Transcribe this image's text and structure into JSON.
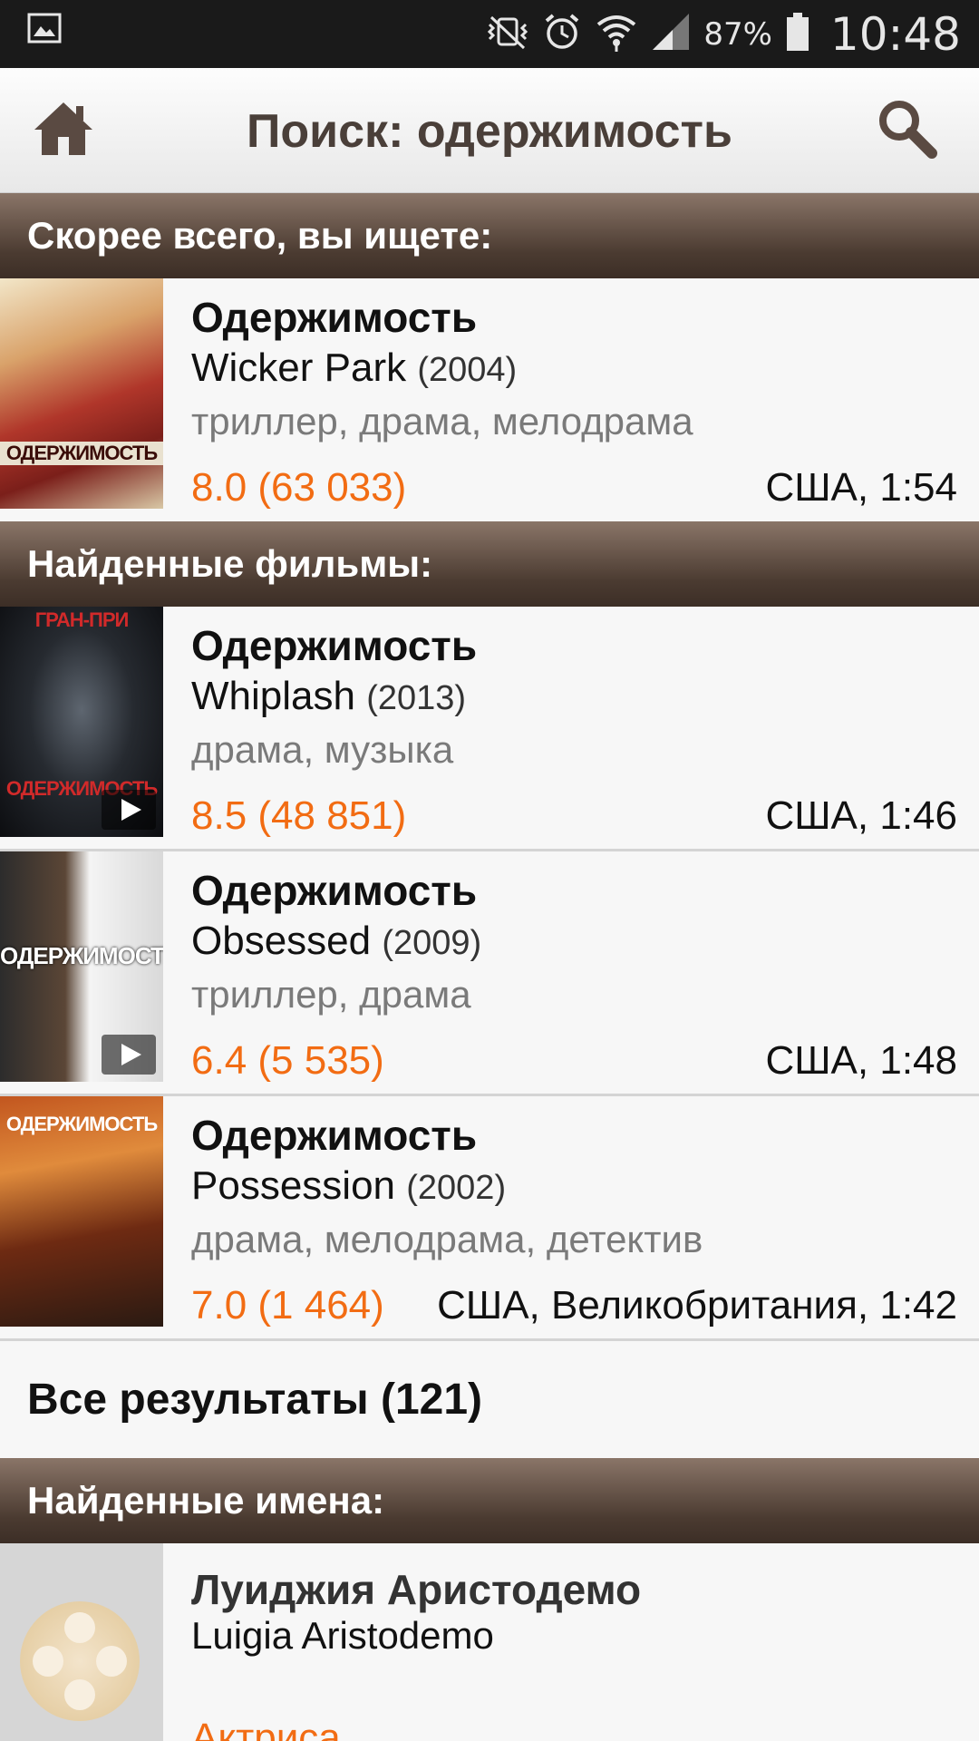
{
  "status_bar": {
    "battery_percent": "87%",
    "time": "10:48",
    "icons": [
      "image-icon",
      "vibrate-mute-icon",
      "alarm-icon",
      "wifi-icon",
      "signal-icon",
      "battery-icon"
    ]
  },
  "action_bar": {
    "title": "Поиск: одержимость",
    "home_icon": "home-icon",
    "search_icon": "search-icon"
  },
  "sections": {
    "likely": "Скорее всего, вы ищете:",
    "films": "Найденные фильмы:",
    "names": "Найденные имена:"
  },
  "likely_movie": {
    "title_ru": "Одержимость",
    "title_orig": "Wicker Park",
    "year": "(2004)",
    "genres": "триллер, драма, мелодрама",
    "rating": "8.0 (63 033)",
    "meta": "США, 1:54"
  },
  "films": [
    {
      "title_ru": "Одержимость",
      "title_orig": "Whiplash",
      "year": "(2013)",
      "genres": "драма, музыка",
      "rating": "8.5 (48 851)",
      "meta": "США, 1:46"
    },
    {
      "title_ru": "Одержимость",
      "title_orig": "Obsessed",
      "year": "(2009)",
      "genres": "триллер, драма",
      "rating": "6.4 (5 535)",
      "meta": "США, 1:48"
    },
    {
      "title_ru": "Одержимость",
      "title_orig": "Possession",
      "year": "(2002)",
      "genres": "драма, мелодрама, детектив",
      "rating": "7.0 (1 464)",
      "meta": "США, Великобритания, 1:42"
    }
  ],
  "all_results": "Все результаты (121)",
  "person": {
    "name_ru": "Луиджия Аристодемо",
    "name_orig": "Luigia Aristodemo",
    "role": "Актриса"
  },
  "colors": {
    "accent_orange": "#f26c13",
    "header_brown": "#4b3b31"
  }
}
